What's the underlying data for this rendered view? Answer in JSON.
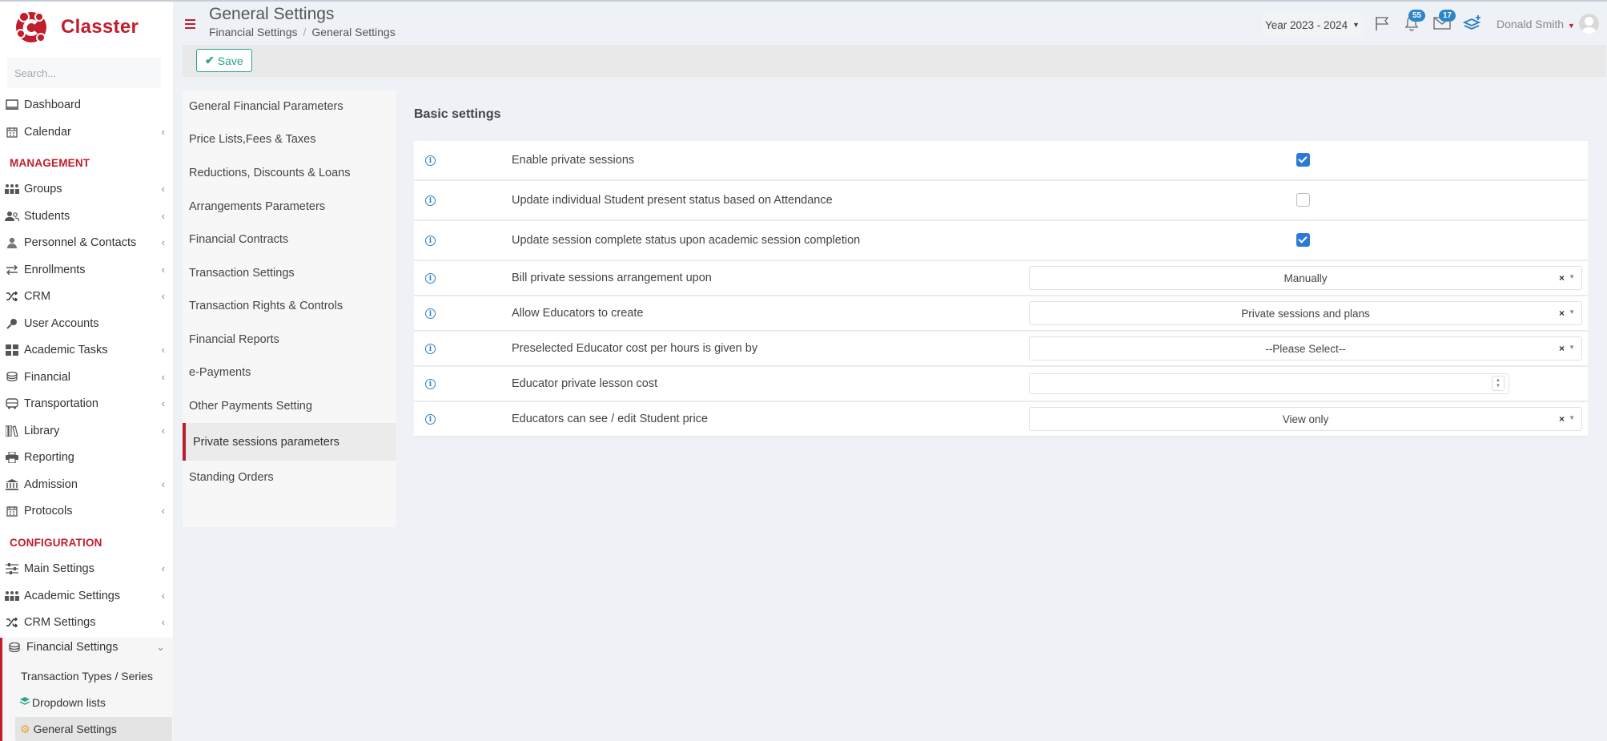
{
  "app": {
    "name": "Classter",
    "brand_color": "#c11d2b"
  },
  "sidebar": {
    "search_placeholder": "Search...",
    "items_top": [
      {
        "label": "Dashboard",
        "icon": "monitor-icon",
        "chevron": false
      },
      {
        "label": "Calendar",
        "icon": "calendar-icon",
        "chevron": true
      }
    ],
    "management_heading": "MANAGEMENT",
    "management_items": [
      {
        "label": "Groups",
        "icon": "groups-icon",
        "chevron": true
      },
      {
        "label": "Students",
        "icon": "students-icon",
        "chevron": true
      },
      {
        "label": "Personnel & Contacts",
        "icon": "person-icon",
        "chevron": true
      },
      {
        "label": "Enrollments",
        "icon": "arrows-icon",
        "chevron": true
      },
      {
        "label": "CRM",
        "icon": "shuffle-icon",
        "chevron": true
      },
      {
        "label": "User Accounts",
        "icon": "key-icon",
        "chevron": false
      },
      {
        "label": "Academic Tasks",
        "icon": "grid-icon",
        "chevron": true
      },
      {
        "label": "Financial",
        "icon": "coins-icon",
        "chevron": true
      },
      {
        "label": "Transportation",
        "icon": "bus-icon",
        "chevron": true
      },
      {
        "label": "Library",
        "icon": "books-icon",
        "chevron": true
      },
      {
        "label": "Reporting",
        "icon": "printer-icon",
        "chevron": false
      },
      {
        "label": "Admission",
        "icon": "bank-icon",
        "chevron": true
      },
      {
        "label": "Protocols",
        "icon": "calendar-icon",
        "chevron": true
      }
    ],
    "configuration_heading": "CONFIGURATION",
    "configuration_items": [
      {
        "label": "Main Settings",
        "icon": "sliders-icon",
        "chevron": true
      },
      {
        "label": "Academic Settings",
        "icon": "groups-icon",
        "chevron": true
      },
      {
        "label": "CRM Settings",
        "icon": "shuffle-icon",
        "chevron": true
      },
      {
        "label": "Financial Settings",
        "icon": "coins-icon",
        "chevron": true
      }
    ],
    "financial_subitems": [
      {
        "label": "Transaction Types / Series",
        "icon": ""
      },
      {
        "label": "Dropdown lists",
        "icon": "layers-icon"
      },
      {
        "label": "General Settings",
        "icon": "gear-icon"
      }
    ]
  },
  "header": {
    "title": "General Settings",
    "breadcrumb": [
      "Financial Settings",
      "General Settings"
    ],
    "year_selector": "Year 2023 - 2024",
    "notification_count": "55",
    "message_count": "17",
    "user_name": "Donald Smith"
  },
  "toolbar": {
    "save_label": "Save"
  },
  "settings_menu": [
    "General Financial Parameters",
    "Price Lists,Fees & Taxes",
    "Reductions, Discounts & Loans",
    "Arrangements Parameters",
    "Financial Contracts",
    "Transaction Settings",
    "Transaction Rights & Controls",
    "Financial Reports",
    "e-Payments",
    "Other Payments Setting",
    "Private sessions parameters",
    "Standing Orders"
  ],
  "main": {
    "section_title": "Basic settings",
    "rows": [
      {
        "label": "Enable private sessions",
        "control": "checkbox",
        "checked": true
      },
      {
        "label": "Update individual Student present status based on Attendance",
        "control": "checkbox",
        "checked": false
      },
      {
        "label": "Update session complete status upon academic session completion",
        "control": "checkbox",
        "checked": true
      },
      {
        "label": "Bill private sessions arrangement upon",
        "control": "select",
        "value": "Manually"
      },
      {
        "label": "Allow Educators to create",
        "control": "select",
        "value": "Private sessions and plans"
      },
      {
        "label": "Preselected Educator cost per hours is given by",
        "control": "select",
        "value": "--Please Select--"
      },
      {
        "label": "Educator private lesson cost",
        "control": "number",
        "value": ""
      },
      {
        "label": "Educators can see / edit Student price",
        "control": "select",
        "value": "View only"
      }
    ]
  },
  "colors": {
    "checkbox_checked": "#2b7bd6",
    "save_green": "#2aa38a",
    "badge_blue": "#2a86c9",
    "info_blue": "#2a7fc4"
  }
}
